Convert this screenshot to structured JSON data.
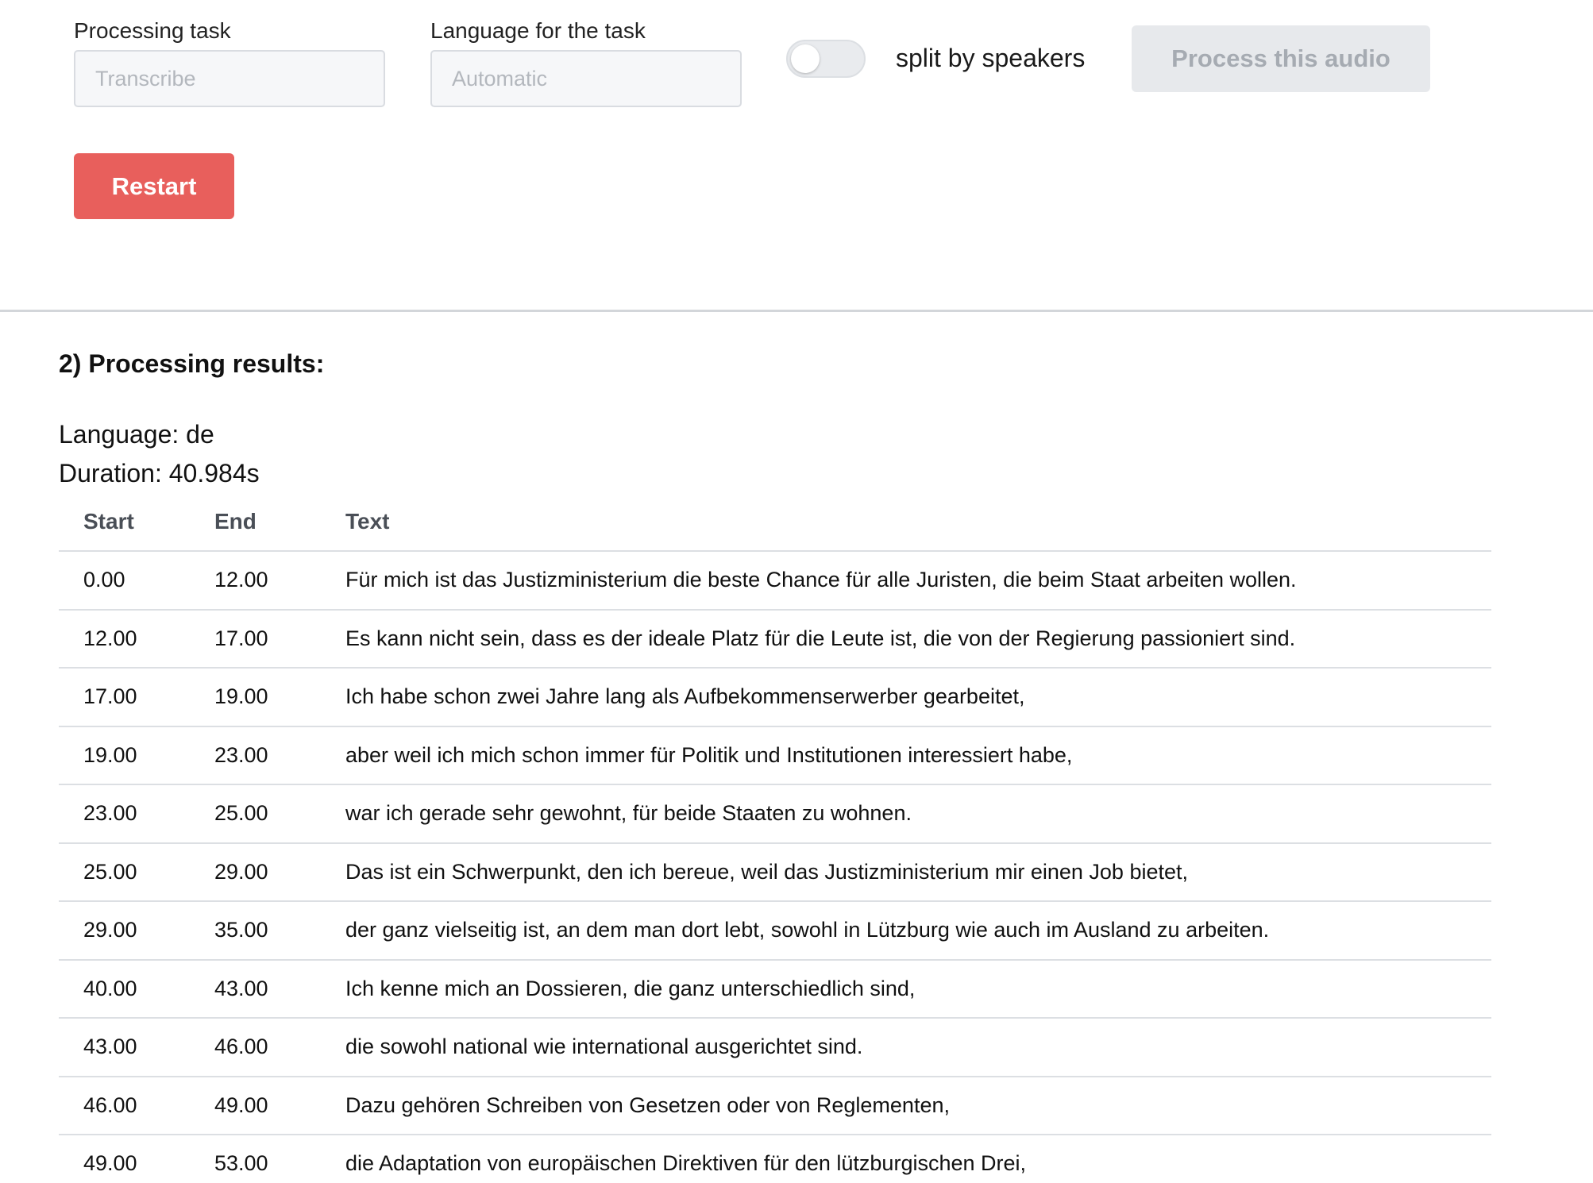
{
  "form": {
    "task_label": "Processing task",
    "task_placeholder": "Transcribe",
    "language_label": "Language for the task",
    "language_placeholder": "Automatic",
    "split_speakers_label": "split by speakers",
    "split_speakers_enabled": false,
    "process_button": "Process this audio",
    "restart_button": "Restart"
  },
  "results": {
    "heading": "2) Processing results:",
    "language_prefix": "Language: ",
    "language_value": "de",
    "duration_prefix": "Duration: ",
    "duration_value": "40.984s",
    "columns": {
      "start": "Start",
      "end": "End",
      "text": "Text"
    },
    "rows": [
      {
        "start": "0.00",
        "end": "12.00",
        "text": "Für mich ist das Justizministerium die beste Chance für alle Juristen, die beim Staat arbeiten wollen."
      },
      {
        "start": "12.00",
        "end": "17.00",
        "text": "Es kann nicht sein, dass es der ideale Platz für die Leute ist, die von der Regierung passioniert sind."
      },
      {
        "start": "17.00",
        "end": "19.00",
        "text": "Ich habe schon zwei Jahre lang als Aufbekommenserwerber gearbeitet,"
      },
      {
        "start": "19.00",
        "end": "23.00",
        "text": "aber weil ich mich schon immer für Politik und Institutionen interessiert habe,"
      },
      {
        "start": "23.00",
        "end": "25.00",
        "text": "war ich gerade sehr gewohnt, für beide Staaten zu wohnen."
      },
      {
        "start": "25.00",
        "end": "29.00",
        "text": "Das ist ein Schwerpunkt, den ich bereue, weil das Justizministerium mir einen Job bietet,"
      },
      {
        "start": "29.00",
        "end": "35.00",
        "text": "der ganz vielseitig ist, an dem man dort lebt, sowohl in Lützburg wie auch im Ausland zu arbeiten."
      },
      {
        "start": "40.00",
        "end": "43.00",
        "text": "Ich kenne mich an Dossieren, die ganz unterschiedlich sind,"
      },
      {
        "start": "43.00",
        "end": "46.00",
        "text": "die sowohl national wie international ausgerichtet sind."
      },
      {
        "start": "46.00",
        "end": "49.00",
        "text": "Dazu gehören Schreiben von Gesetzen oder von Reglementen,"
      },
      {
        "start": "49.00",
        "end": "53.00",
        "text": "die Adaptation von europäischen Direktiven für den lützburgischen Drei,"
      }
    ]
  }
}
